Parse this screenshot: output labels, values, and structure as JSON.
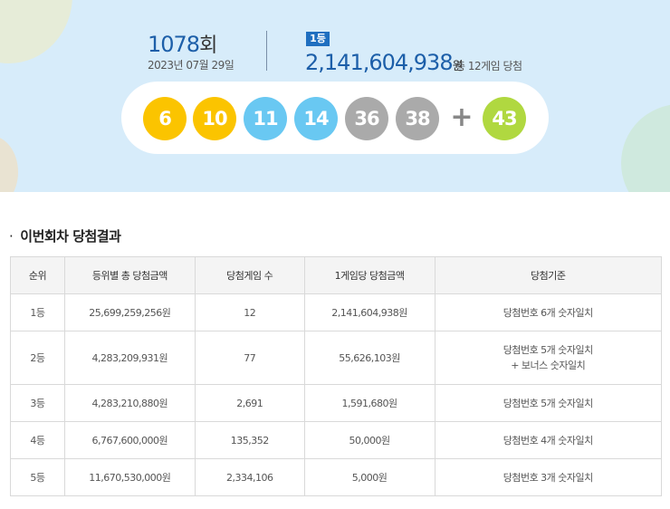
{
  "draw": {
    "round_number": "1078",
    "round_unit": "회",
    "date": "2023년 07월 29일"
  },
  "first_prize": {
    "badge": "1등",
    "amount": "2,141,604,938",
    "unit": "원",
    "games": "총 12게임 당첨"
  },
  "balls": [
    {
      "number": "6",
      "color": "#fbc400"
    },
    {
      "number": "10",
      "color": "#fbc400"
    },
    {
      "number": "11",
      "color": "#69c8f2"
    },
    {
      "number": "14",
      "color": "#69c8f2"
    },
    {
      "number": "36",
      "color": "#aaaaaa"
    },
    {
      "number": "38",
      "color": "#aaaaaa"
    }
  ],
  "plus_sign": "+",
  "bonus_ball": {
    "number": "43",
    "color": "#b0d840"
  },
  "section_title": "이번회차 당첨결과",
  "table": {
    "headers": [
      "순위",
      "등위별 총 당첨금액",
      "당첨게임 수",
      "1게임당 당첨금액",
      "당첨기준"
    ],
    "rows": [
      {
        "rank": "1등",
        "total": "25,699,259,256원",
        "count": "12",
        "per_game": "2,141,604,938원",
        "criteria": [
          "당첨번호 6개 숫자일치"
        ]
      },
      {
        "rank": "2등",
        "total": "4,283,209,931원",
        "count": "77",
        "per_game": "55,626,103원",
        "criteria": [
          "당첨번호 5개 숫자일치",
          "+ 보너스 숫자일치"
        ]
      },
      {
        "rank": "3등",
        "total": "4,283,210,880원",
        "count": "2,691",
        "per_game": "1,591,680원",
        "criteria": [
          "당첨번호 5개 숫자일치"
        ]
      },
      {
        "rank": "4등",
        "total": "6,767,600,000원",
        "count": "135,352",
        "per_game": "50,000원",
        "criteria": [
          "당첨번호 4개 숫자일치"
        ]
      },
      {
        "rank": "5등",
        "total": "11,670,530,000원",
        "count": "2,334,106",
        "per_game": "5,000원",
        "criteria": [
          "당첨번호 3개 숫자일치"
        ]
      }
    ]
  }
}
